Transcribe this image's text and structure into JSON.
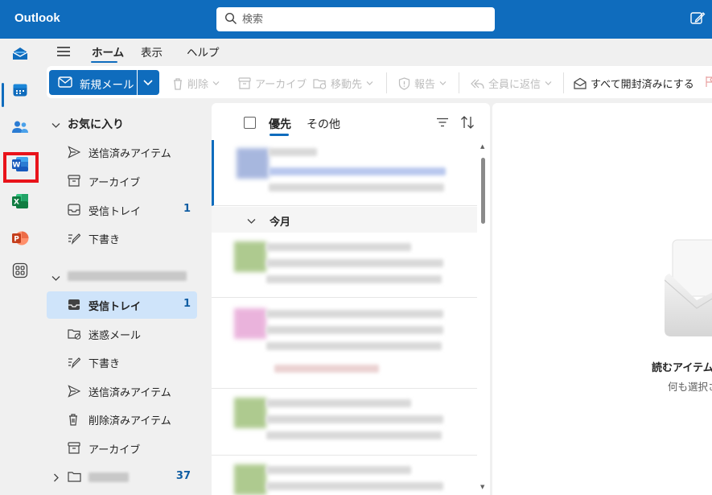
{
  "app": {
    "title": "Outlook"
  },
  "search": {
    "placeholder": "検索"
  },
  "tabs": {
    "home": "ホーム",
    "view": "表示",
    "help": "ヘルプ"
  },
  "ribbon": {
    "new_mail": "新規メール",
    "delete": "削除",
    "archive": "アーカイブ",
    "move": "移動先",
    "report": "報告",
    "reply_all": "全員に返信",
    "mark_all_read": "すべて開封済みにする"
  },
  "favorites": {
    "title": "お気に入り",
    "items": [
      {
        "label": "送信済みアイテム",
        "icon": "send-icon",
        "count": ""
      },
      {
        "label": "アーカイブ",
        "icon": "archive-icon",
        "count": ""
      },
      {
        "label": "受信トレイ",
        "icon": "inbox-icon",
        "count": "1"
      },
      {
        "label": "下書き",
        "icon": "draft-icon",
        "count": ""
      }
    ]
  },
  "account": {
    "items": [
      {
        "label": "受信トレイ",
        "icon": "inbox-icon",
        "count": "1",
        "selected": true
      },
      {
        "label": "迷惑メール",
        "icon": "junk-icon",
        "count": ""
      },
      {
        "label": "下書き",
        "icon": "draft-icon",
        "count": ""
      },
      {
        "label": "送信済みアイテム",
        "icon": "send-icon",
        "count": ""
      },
      {
        "label": "削除済みアイテム",
        "icon": "trash-icon",
        "count": ""
      },
      {
        "label": "アーカイブ",
        "icon": "archive-icon",
        "count": ""
      }
    ],
    "folder_count": "37"
  },
  "message_list": {
    "focused_tab": "優先",
    "other_tab": "その他",
    "group_label": "今月"
  },
  "reading_pane": {
    "title": "読むアイテムを",
    "subtitle": "何も選択さ"
  },
  "colors": {
    "brand": "#0f6cbd",
    "highlight": "#e8131a",
    "selected_folder": "#cfe4fa"
  }
}
